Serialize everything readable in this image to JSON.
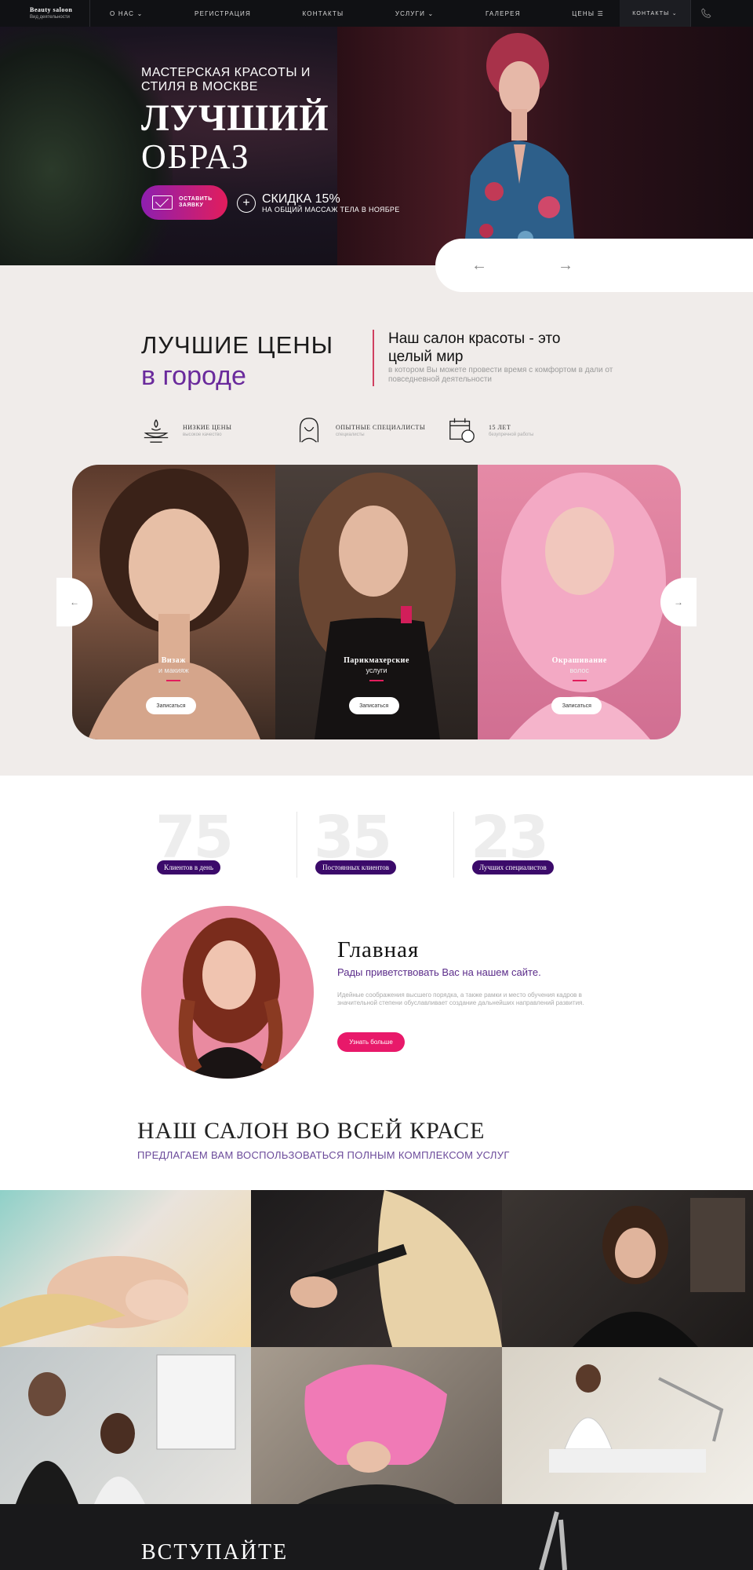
{
  "brand": {
    "name": "Beauty saloon",
    "tagline": "Вид деятельности"
  },
  "nav": {
    "items": [
      "О НАС",
      "РЕГИСТРАЦИЯ",
      "КОНТАКТЫ",
      "УСЛУГИ",
      "ГАЛЕРЕЯ",
      "ЦЕНЫ"
    ],
    "contact": "КОНТАКТЫ"
  },
  "hero": {
    "subtitle": "МАСТЕРСКАЯ КРАСОТЫ И СТИЛЯ В МОСКВЕ",
    "title_line1": "ЛУЧШИЙ",
    "title_line2": "ОБРАЗ",
    "cta": "ОСТАВИТЬ ЗАЯВКУ",
    "promo_title": "СКИДКА 15%",
    "promo_text": "НА ОБЩИЙ МАССАЖ ТЕЛА В НОЯБРЕ"
  },
  "prices": {
    "heading_line1": "ЛУЧШИЕ ЦЕНЫ",
    "heading_line2": "в городе",
    "world_title": "Наш салон красоты - это целый мир",
    "world_text": "в котором Вы можете провести время с комфортом в дали от повседневной деятельности"
  },
  "features": [
    {
      "title": "НИЗКИЕ ЦЕНЫ",
      "subtitle": "высокое качество"
    },
    {
      "title": "ОПЫТНЫЕ СПЕЦИАЛИСТЫ",
      "subtitle": "специалисты"
    },
    {
      "title": "15 ЛЕТ",
      "subtitle": "безупречной работы"
    }
  ],
  "services": [
    {
      "title": "Визаж",
      "subtitle": "и макияж",
      "button": "Записаться"
    },
    {
      "title": "Парикмахерские",
      "subtitle": "услуги",
      "button": "Записаться"
    },
    {
      "title": "Окрашивание",
      "subtitle": "волос",
      "button": "Записаться"
    }
  ],
  "stats": [
    {
      "value": "75",
      "label": "Клиентов в день"
    },
    {
      "value": "35",
      "label": "Постоянных клиентов"
    },
    {
      "value": "23",
      "label": "Лучших специалистов"
    }
  ],
  "welcome": {
    "title": "Главная",
    "subtitle": "Рады приветствовать Вас на нашем сайте.",
    "text": "Идейные соображения высшего порядка, а также рамки и место обучения кадров в значительной степени обуславливает создание дальнейших направлений развития.",
    "button": "Узнать больше"
  },
  "salon": {
    "title": "НАШ САЛОН ВО ВСЕЙ КРАСЕ",
    "subtitle": "ПРЕДЛАГАЕМ ВАМ ВОСПОЛЬЗОВАТЬСЯ ПОЛНЫМ КОМПЛЕКСОМ УСЛУГ"
  },
  "join": {
    "title": "ВСТУПАЙТЕ"
  },
  "colors": {
    "accent": "#e8196a",
    "purple": "#3b0a6a",
    "dark": "#101114"
  }
}
